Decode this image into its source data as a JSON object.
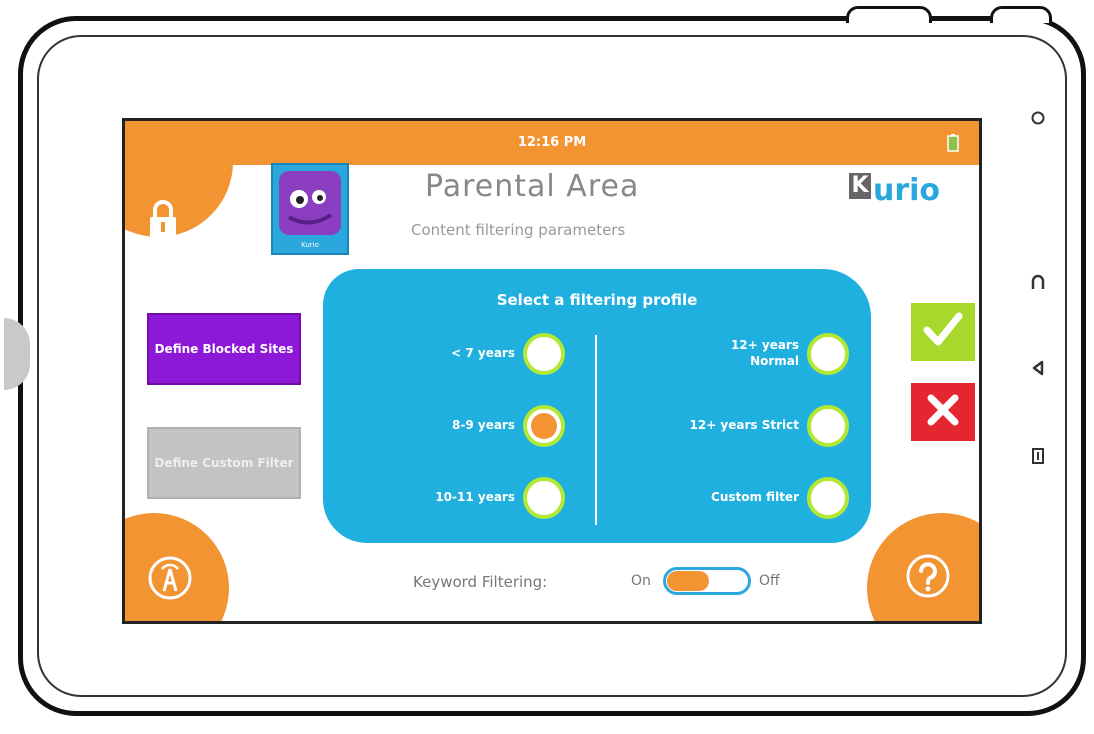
{
  "status_bar": {
    "time": "12:16 PM"
  },
  "header": {
    "title": "Parental Area",
    "subtitle": "Content filtering parameters",
    "logo_letter": "K",
    "logo_text": "urio"
  },
  "avatar": {
    "name": "Kurio"
  },
  "side_buttons": {
    "blocked_sites": "Define Blocked Sites",
    "custom_filter": "Define Custom Filter"
  },
  "filter_panel": {
    "title": "Select a filtering profile",
    "options": [
      {
        "label": "< 7 years",
        "selected": false
      },
      {
        "label": "8-9 years",
        "selected": true
      },
      {
        "label": "10-11 years",
        "selected": false
      },
      {
        "label": "12+ years Normal",
        "selected": false
      },
      {
        "label": "12+ years Strict",
        "selected": false
      },
      {
        "label": "Custom filter",
        "selected": false
      }
    ]
  },
  "keyword_filtering": {
    "label": "Keyword Filtering:",
    "on_label": "On",
    "off_label": "Off",
    "state": "On"
  },
  "colors": {
    "accent_orange": "#f39433",
    "panel_blue": "#1fb0e0",
    "confirm_green": "#a8d82c",
    "cancel_red": "#e3262f",
    "blocked_purple": "#8d18d8"
  },
  "icons": [
    "wifi-icon",
    "battery-icon",
    "lock-icon",
    "avatar-icon",
    "check-icon",
    "close-icon",
    "network-icon",
    "help-icon",
    "home-icon",
    "headphones-icon",
    "back-icon",
    "recent-apps-icon"
  ]
}
